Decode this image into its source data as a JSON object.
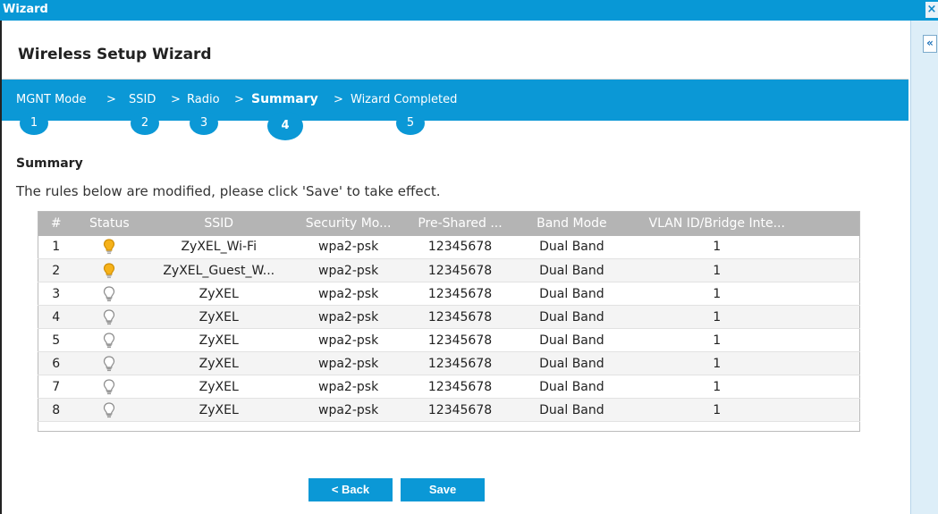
{
  "window": {
    "title": "Wizard",
    "close_glyph": "×"
  },
  "side_panel": {
    "collapse_glyph": "«"
  },
  "header": {
    "title": "Wireless Setup Wizard"
  },
  "steps": [
    {
      "label": "MGNT Mode",
      "number": "1"
    },
    {
      "label": "SSID",
      "number": "2"
    },
    {
      "label": "Radio",
      "number": "3"
    },
    {
      "label": "Summary",
      "number": "4",
      "active": true
    },
    {
      "label": "Wizard Completed",
      "number": "5"
    }
  ],
  "step_separator": ">",
  "summary": {
    "heading": "Summary",
    "note": "The rules below are modified, please click 'Save' to take effect."
  },
  "table": {
    "columns": [
      "#",
      "Status",
      "SSID",
      "Security Mo...",
      "Pre-Shared ...",
      "Band Mode",
      "VLAN ID/Bridge Inte..."
    ],
    "rows": [
      {
        "num": "1",
        "status": "on",
        "ssid": "ZyXEL_Wi-Fi",
        "security": "wpa2-psk",
        "psk": "12345678",
        "band": "Dual Band",
        "vlan": "1"
      },
      {
        "num": "2",
        "status": "on",
        "ssid": "ZyXEL_Guest_W...",
        "security": "wpa2-psk",
        "psk": "12345678",
        "band": "Dual Band",
        "vlan": "1"
      },
      {
        "num": "3",
        "status": "off",
        "ssid": "ZyXEL",
        "security": "wpa2-psk",
        "psk": "12345678",
        "band": "Dual Band",
        "vlan": "1"
      },
      {
        "num": "4",
        "status": "off",
        "ssid": "ZyXEL",
        "security": "wpa2-psk",
        "psk": "12345678",
        "band": "Dual Band",
        "vlan": "1"
      },
      {
        "num": "5",
        "status": "off",
        "ssid": "ZyXEL",
        "security": "wpa2-psk",
        "psk": "12345678",
        "band": "Dual Band",
        "vlan": "1"
      },
      {
        "num": "6",
        "status": "off",
        "ssid": "ZyXEL",
        "security": "wpa2-psk",
        "psk": "12345678",
        "band": "Dual Band",
        "vlan": "1"
      },
      {
        "num": "7",
        "status": "off",
        "ssid": "ZyXEL",
        "security": "wpa2-psk",
        "psk": "12345678",
        "band": "Dual Band",
        "vlan": "1"
      },
      {
        "num": "8",
        "status": "off",
        "ssid": "ZyXEL",
        "security": "wpa2-psk",
        "psk": "12345678",
        "band": "Dual Band",
        "vlan": "1"
      }
    ]
  },
  "buttons": {
    "back": "< Back",
    "save": "Save"
  },
  "colors": {
    "accent": "#0b98d6",
    "bulb_on": "#f6b21a",
    "bulb_off": "#8a8a8a"
  },
  "icons": {
    "status_on": "lightbulb-on-icon",
    "status_off": "lightbulb-off-icon"
  }
}
